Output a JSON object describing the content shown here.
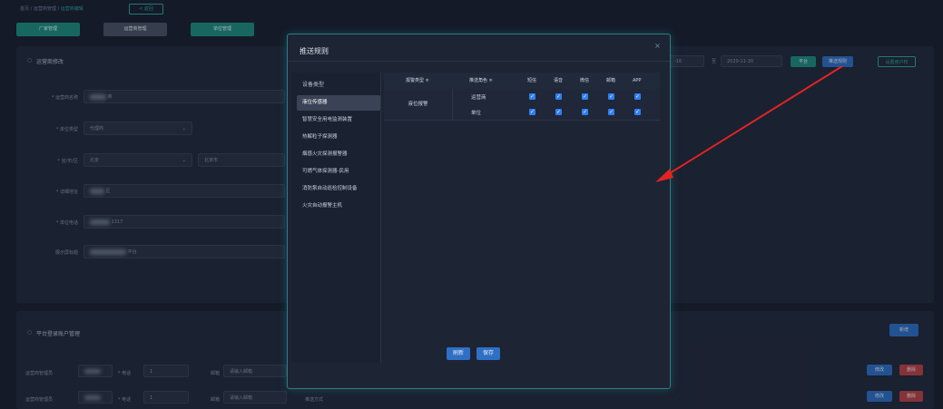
{
  "breadcrumb": {
    "text": "首页 / 运营商管理 /",
    "current": "运营商编辑",
    "back_button": "< 返回"
  },
  "tabs": [
    {
      "label": "厂家管理",
      "color": "#1f8c80"
    },
    {
      "label": "运营商管理",
      "color": "#4a5264"
    },
    {
      "label": "单位管理",
      "color": "#1f8c80"
    }
  ],
  "operator_form": {
    "title": "运营商修改",
    "fields": [
      {
        "label": "* 运营商名称",
        "value": "商"
      },
      {
        "label": "* 单位类型",
        "value": "代理商"
      },
      {
        "label": "* 省/市/区",
        "value": "北京",
        "value2": "北京市"
      },
      {
        "label": "* 详细地址",
        "value": "区"
      },
      {
        "label": "* 单位电话",
        "value": "1317"
      },
      {
        "label": "展示屏标题",
        "value": "平台"
      }
    ]
  },
  "right_toolbar": {
    "date_start": "-16",
    "date_sep": "至",
    "date_end": "2020-11-30",
    "platform_button": "平台",
    "push_rules_button": "推送规则",
    "set_users_button": "设置用户权"
  },
  "accounts": {
    "title": "平台登录账户管理",
    "add_button": "新增",
    "rows": [
      {
        "role": "运营商管理员",
        "phone_label": "* 电话",
        "phone_prefix": "1",
        "email_label": "邮箱",
        "email_placeholder": "请输入邮箱",
        "edit_button": "修改",
        "delete_button": "删除"
      },
      {
        "role": "运营商管理员",
        "phone_label": "* 电话",
        "phone_prefix": "1",
        "email_label": "邮箱",
        "email_placeholder": "请输入邮箱",
        "push_label": "推送方式",
        "edit_button": "修改",
        "delete_button": "删除"
      }
    ]
  },
  "modal": {
    "title": "推送规则",
    "close": "×",
    "device_types_header": "设备类型",
    "device_types": [
      "液位传感器",
      "智慧安全用电监测装置",
      "热解粒子探测器",
      "烟感火灾探测报警器",
      "可燃气体探测器-民用",
      "消防泵自动巡检控制设备",
      "火灾自动报警主机"
    ],
    "selected_index": 0,
    "columns": [
      "报警类型 ≑",
      "推送角色 ≑",
      "短信",
      "语音",
      "微信",
      "邮箱",
      "APP"
    ],
    "group_label": "液位报警",
    "rows": [
      {
        "role": "运营商",
        "checks": [
          true,
          true,
          true,
          true,
          true
        ]
      },
      {
        "role": "单位",
        "checks": [
          true,
          true,
          true,
          true,
          true
        ]
      }
    ],
    "refresh_button": "刷新",
    "save_button": "保存"
  }
}
